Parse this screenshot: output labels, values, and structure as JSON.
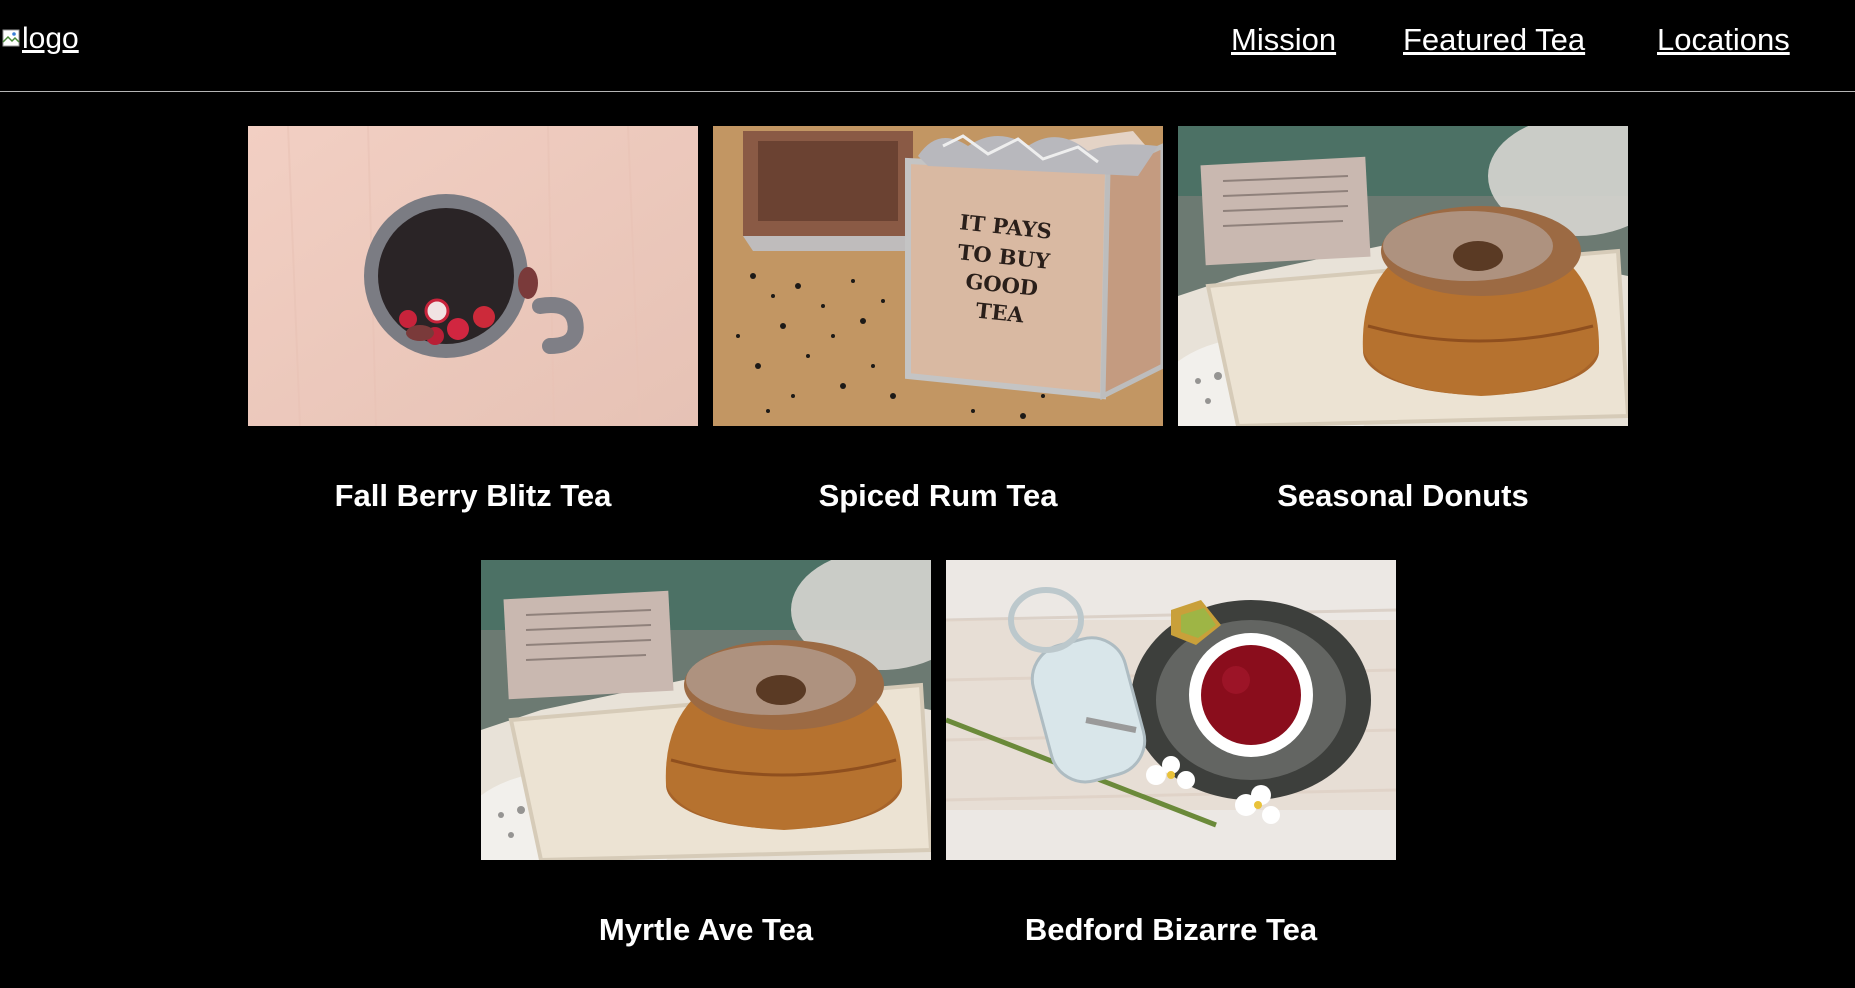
{
  "header": {
    "logo_alt": "logo",
    "nav": [
      {
        "label": "Mission"
      },
      {
        "label": "Featured Tea"
      },
      {
        "label": "Locations"
      }
    ]
  },
  "menu": {
    "items": [
      {
        "name": "Fall Berry Blitz Tea",
        "photo": "mug-with-berries"
      },
      {
        "name": "Spiced Rum Tea",
        "photo": "tea-crate-it-pays-to-buy-good-tea",
        "crate_text": [
          "IT PAYS",
          "TO BUY",
          "GOOD",
          "TEA"
        ]
      },
      {
        "name": "Seasonal Donuts",
        "photo": "sugar-dusted-donut"
      },
      {
        "name": "Myrtle Ave Tea",
        "photo": "sugar-dusted-donut"
      },
      {
        "name": "Bedford Bizarre Tea",
        "photo": "tea-cup-and-sugar-jar"
      }
    ]
  },
  "colors": {
    "background": "#000000",
    "text": "#ffffff",
    "divider": "#b5b5b5"
  }
}
